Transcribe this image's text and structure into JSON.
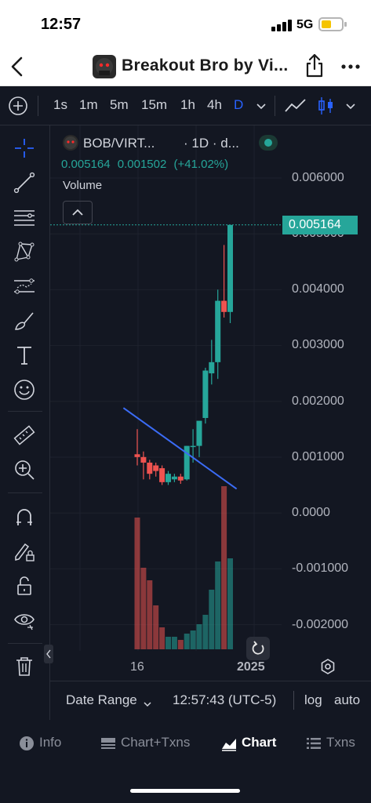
{
  "status_bar": {
    "time": "12:57",
    "network": "5G"
  },
  "nav": {
    "title": "Breakout Bro by Vi..."
  },
  "toolbar": {
    "intervals": [
      "1s",
      "1m",
      "5m",
      "15m",
      "1h",
      "4h",
      "D"
    ],
    "active_interval": "D"
  },
  "legend": {
    "symbol": "BOB/VIRT...",
    "interval": "· 1D · d...",
    "close": "0.005164",
    "change": "0.001502",
    "change_pct": "(+41.02%)",
    "volume_label": "Volume"
  },
  "price_axis": {
    "labels": [
      "0.006000",
      "0.005000",
      "0.004000",
      "0.003000",
      "0.002000",
      "0.001000",
      "0.0000",
      "-0.001000",
      "-0.002000"
    ],
    "last_price": "0.005164"
  },
  "date_axis": {
    "labels": [
      "16",
      "2025"
    ]
  },
  "bottom_bar": {
    "date_range": "Date Range",
    "time": "12:57:43 (UTC-5)",
    "log": "log",
    "auto": "auto"
  },
  "tabs": [
    {
      "label": "Info",
      "icon": "info-icon"
    },
    {
      "label": "Chart+Txns",
      "icon": "chart-txns-icon"
    },
    {
      "label": "Chart",
      "icon": "chart-icon",
      "active": true
    },
    {
      "label": "Txns",
      "icon": "list-icon"
    }
  ],
  "colors": {
    "up": "#26a69a",
    "down": "#ef5350",
    "accent": "#2962ff",
    "background": "#131722"
  },
  "chart_data": {
    "type": "candlestick",
    "y_range": [
      -0.0025,
      0.0063
    ],
    "candles": [
      {
        "o": 0.00105,
        "h": 0.0015,
        "l": 0.00085,
        "c": 0.001
      },
      {
        "o": 0.001,
        "h": 0.0011,
        "l": 0.0006,
        "c": 0.0009
      },
      {
        "o": 0.0009,
        "h": 0.00095,
        "l": 0.0006,
        "c": 0.0007
      },
      {
        "o": 0.00085,
        "h": 0.0009,
        "l": 0.00065,
        "c": 0.00075
      },
      {
        "o": 0.0008,
        "h": 0.00085,
        "l": 0.0005,
        "c": 0.00055
      },
      {
        "o": 0.00055,
        "h": 0.00075,
        "l": 0.0005,
        "c": 0.0007
      },
      {
        "o": 0.0006,
        "h": 0.0007,
        "l": 0.00055,
        "c": 0.00065
      },
      {
        "o": 0.00065,
        "h": 0.0007,
        "l": 0.00052,
        "c": 0.00058
      },
      {
        "o": 0.0006,
        "h": 0.0012,
        "l": 0.00058,
        "c": 0.0012
      },
      {
        "o": 0.0012,
        "h": 0.0015,
        "l": 0.0009,
        "c": 0.0012
      },
      {
        "o": 0.0012,
        "h": 0.0016,
        "l": 0.001,
        "c": 0.00165
      },
      {
        "o": 0.0017,
        "h": 0.0026,
        "l": 0.0016,
        "c": 0.00255
      },
      {
        "o": 0.0025,
        "h": 0.0031,
        "l": 0.0023,
        "c": 0.0027
      },
      {
        "o": 0.0027,
        "h": 0.004,
        "l": 0.0024,
        "c": 0.0038
      },
      {
        "o": 0.0038,
        "h": 0.0048,
        "l": 0.0035,
        "c": 0.0036
      },
      {
        "o": 0.0036,
        "h": 0.00516,
        "l": 0.0034,
        "c": 0.00516
      }
    ],
    "volume": [
      0.42,
      0.26,
      0.22,
      0.14,
      0.07,
      0.04,
      0.04,
      0.03,
      0.05,
      0.06,
      0.08,
      0.11,
      0.19,
      0.28,
      0.52,
      0.29
    ],
    "trendline": [
      [
        0.3,
        0.00188
      ],
      [
        13.5,
        0.00043
      ]
    ]
  }
}
